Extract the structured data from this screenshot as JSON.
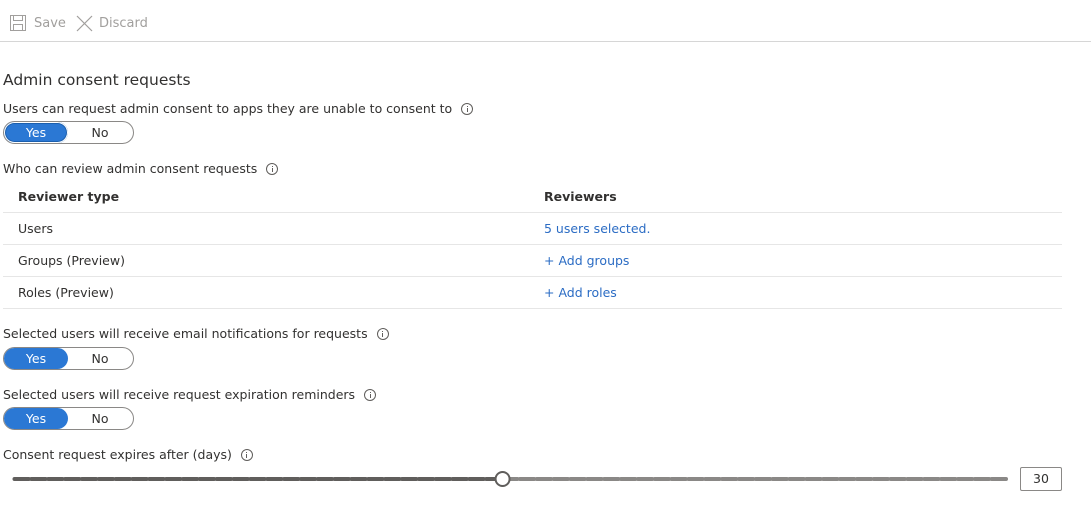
{
  "toolbar": {
    "save_label": "Save",
    "save_icon": "floppy-disk-icon",
    "discard_label": "Discard",
    "discard_icon": "close-x-icon",
    "disabled_color": "#a19f9d"
  },
  "section_title": "Admin consent requests",
  "request_consent": {
    "label": "Users can request admin consent to apps they are unable to consent to",
    "options": [
      "Yes",
      "No"
    ],
    "selected": "Yes"
  },
  "reviewers": {
    "label": "Who can review admin consent requests",
    "columns": [
      "Reviewer type",
      "Reviewers"
    ],
    "rows": [
      {
        "type": "Users",
        "reviewers": "5 users selected."
      },
      {
        "type": "Groups (Preview)",
        "reviewers": "+ Add groups"
      },
      {
        "type": "Roles (Preview)",
        "reviewers": "+ Add roles"
      }
    ]
  },
  "email_notifications": {
    "label": "Selected users will receive email notifications for requests",
    "options": [
      "Yes",
      "No"
    ],
    "selected": "Yes"
  },
  "expiration_reminders": {
    "label": "Selected users will receive request expiration reminders",
    "options": [
      "Yes",
      "No"
    ],
    "selected": "Yes"
  },
  "expiry": {
    "label": "Consent request expires after (days)",
    "value": "30",
    "min": 1,
    "max": 60
  },
  "colors": {
    "accent": "#2b78d4",
    "link": "#2b6cc4",
    "slider_filled": "#605e5c",
    "slider_empty": "#8a8886"
  }
}
